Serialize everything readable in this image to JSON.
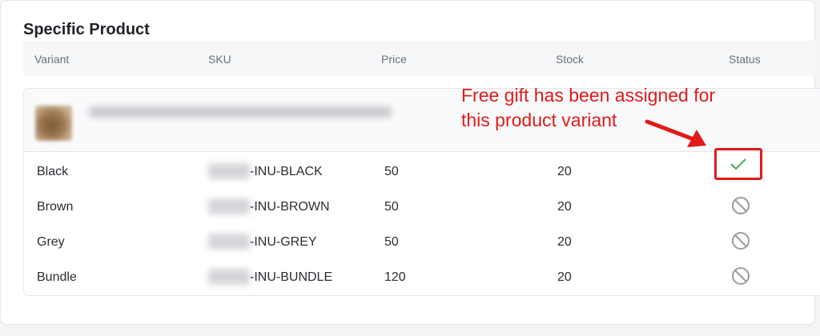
{
  "section": {
    "title": "Specific Product"
  },
  "columns": {
    "variant": "Variant",
    "sku": "SKU",
    "price": "Price",
    "stock": "Stock",
    "status": "Status"
  },
  "rows": [
    {
      "variant": "Black",
      "sku": "-INU-BLACK",
      "price": "50",
      "stock": "20",
      "status": "assigned"
    },
    {
      "variant": "Brown",
      "sku": "-INU-BROWN",
      "price": "50",
      "stock": "20",
      "status": "unassigned"
    },
    {
      "variant": "Grey",
      "sku": "-INU-GREY",
      "price": "50",
      "stock": "20",
      "status": "unassigned"
    },
    {
      "variant": "Bundle",
      "sku": "-INU-BUNDLE",
      "price": "120",
      "stock": "20",
      "status": "unassigned"
    }
  ],
  "annotation": {
    "line1": "Free gift has been assigned for",
    "line2": "this product variant"
  },
  "icons": {
    "assigned": "check-icon",
    "unassigned": "ban-icon"
  },
  "colors": {
    "check": "#43b049",
    "annotation": "#e21919",
    "ban": "#9a9ca0"
  }
}
